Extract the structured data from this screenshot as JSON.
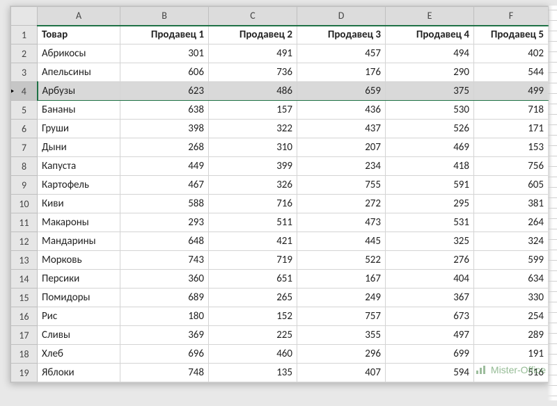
{
  "colors": {
    "selection": "#1e7145",
    "row_sel_bg": "#d9d9d9"
  },
  "columns": [
    "A",
    "B",
    "C",
    "D",
    "E",
    "F"
  ],
  "headers": [
    "Товар",
    "Продавец 1",
    "Продавец 2",
    "Продавец 3",
    "Продавец 4",
    "Продавец 5"
  ],
  "selected_row_index": 3,
  "rows": [
    {
      "n": 1,
      "label": "Товар",
      "v": []
    },
    {
      "n": 2,
      "label": "Абрикосы",
      "v": [
        301,
        491,
        457,
        494,
        402
      ]
    },
    {
      "n": 3,
      "label": "Апельсины",
      "v": [
        606,
        736,
        176,
        290,
        544
      ]
    },
    {
      "n": 4,
      "label": "Арбузы",
      "v": [
        623,
        486,
        659,
        375,
        499
      ]
    },
    {
      "n": 5,
      "label": "Бананы",
      "v": [
        638,
        157,
        436,
        530,
        718
      ]
    },
    {
      "n": 6,
      "label": "Груши",
      "v": [
        398,
        322,
        437,
        526,
        171
      ]
    },
    {
      "n": 7,
      "label": "Дыни",
      "v": [
        268,
        310,
        207,
        469,
        153
      ]
    },
    {
      "n": 8,
      "label": "Капуста",
      "v": [
        449,
        399,
        234,
        418,
        756
      ]
    },
    {
      "n": 9,
      "label": "Картофель",
      "v": [
        467,
        326,
        755,
        591,
        605
      ]
    },
    {
      "n": 10,
      "label": "Киви",
      "v": [
        588,
        716,
        272,
        295,
        381
      ]
    },
    {
      "n": 11,
      "label": "Макароны",
      "v": [
        293,
        511,
        473,
        531,
        264
      ]
    },
    {
      "n": 12,
      "label": "Мандарины",
      "v": [
        648,
        421,
        445,
        325,
        324
      ]
    },
    {
      "n": 13,
      "label": "Морковь",
      "v": [
        743,
        719,
        522,
        276,
        599
      ]
    },
    {
      "n": 14,
      "label": "Персики",
      "v": [
        360,
        651,
        167,
        404,
        634
      ]
    },
    {
      "n": 15,
      "label": "Помидоры",
      "v": [
        689,
        265,
        249,
        367,
        330
      ]
    },
    {
      "n": 16,
      "label": "Рис",
      "v": [
        180,
        152,
        757,
        673,
        254
      ]
    },
    {
      "n": 17,
      "label": "Сливы",
      "v": [
        369,
        225,
        355,
        497,
        289
      ]
    },
    {
      "n": 18,
      "label": "Хлеб",
      "v": [
        696,
        460,
        296,
        699,
        191
      ]
    },
    {
      "n": 19,
      "label": "Яблоки",
      "v": [
        748,
        135,
        407,
        594,
        516
      ]
    }
  ],
  "watermark": "Mister-Office"
}
